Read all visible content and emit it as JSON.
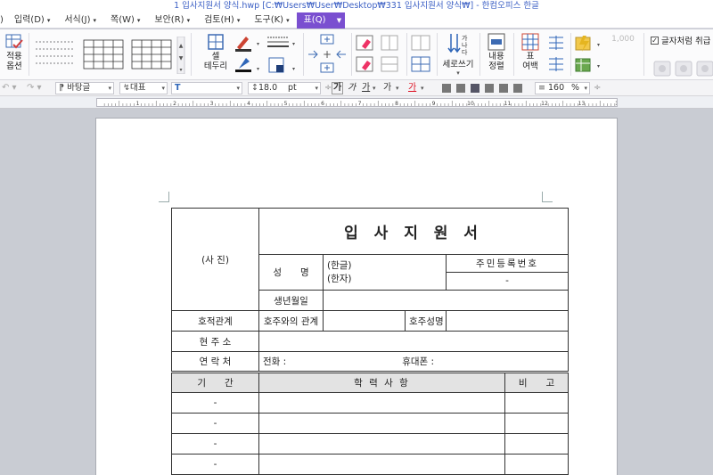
{
  "window": {
    "title": "1 입사지원서 양식.hwp [C:₩Users₩User₩Desktop₩331 입사지원서 양식₩] - 한컴오피스 한글"
  },
  "menu": {
    "items": [
      "입력(D)",
      "서식(J)",
      "쪽(W)",
      "보안(R)",
      "검토(H)",
      "도구(K)"
    ],
    "active": "표(Q)"
  },
  "ribbon": {
    "apply_options": "적용\n옵션",
    "cell_border": "셀\n테두리",
    "vertical_write": "세로쓰기",
    "content_align": "내용\n정렬",
    "table_margin": "표\n여백",
    "disabled_number": "1,000",
    "treat_as_char": "글자처럼 취급",
    "treat_as_char_checked": true
  },
  "format_toolbar": {
    "style": "바탕글",
    "font_lang": "대표",
    "font": "",
    "size": "18.0",
    "size_unit": "pt",
    "bold": "가",
    "italic": "가",
    "underline": "가",
    "strike": "가",
    "color": "가",
    "line_spacing": "160",
    "line_spacing_unit": "%"
  },
  "ruler": {
    "ticks": [
      "1",
      "2",
      "3",
      "4",
      "5",
      "6",
      "7",
      "8",
      "9",
      "10",
      "11",
      "12",
      "13",
      "14"
    ]
  },
  "form": {
    "title": "입 사 지 원 서",
    "photo": "(사 진)",
    "name_label": "성　　명",
    "hangul": "(한글)",
    "hanja": "(한자)",
    "rrn_label": "주민등록번호",
    "rrn_dash": "-",
    "birth_label": "생년월일",
    "family_rel_label": "호적관계",
    "head_rel_label": "호주와의 관계",
    "head_name_label": "호주성명",
    "address_label": "현 주 소",
    "contact_label": "연 락 처",
    "phone_label": "전화 :",
    "mobile_label": "휴대폰 :",
    "period_header": "기　　간",
    "education_header": "학 력 사 항",
    "note_header": "비　　고",
    "period_rows": [
      "-",
      "-",
      "-",
      "-"
    ]
  },
  "colors": {
    "accent": "#7a4fd0",
    "title_text": "#3b5fc4"
  }
}
